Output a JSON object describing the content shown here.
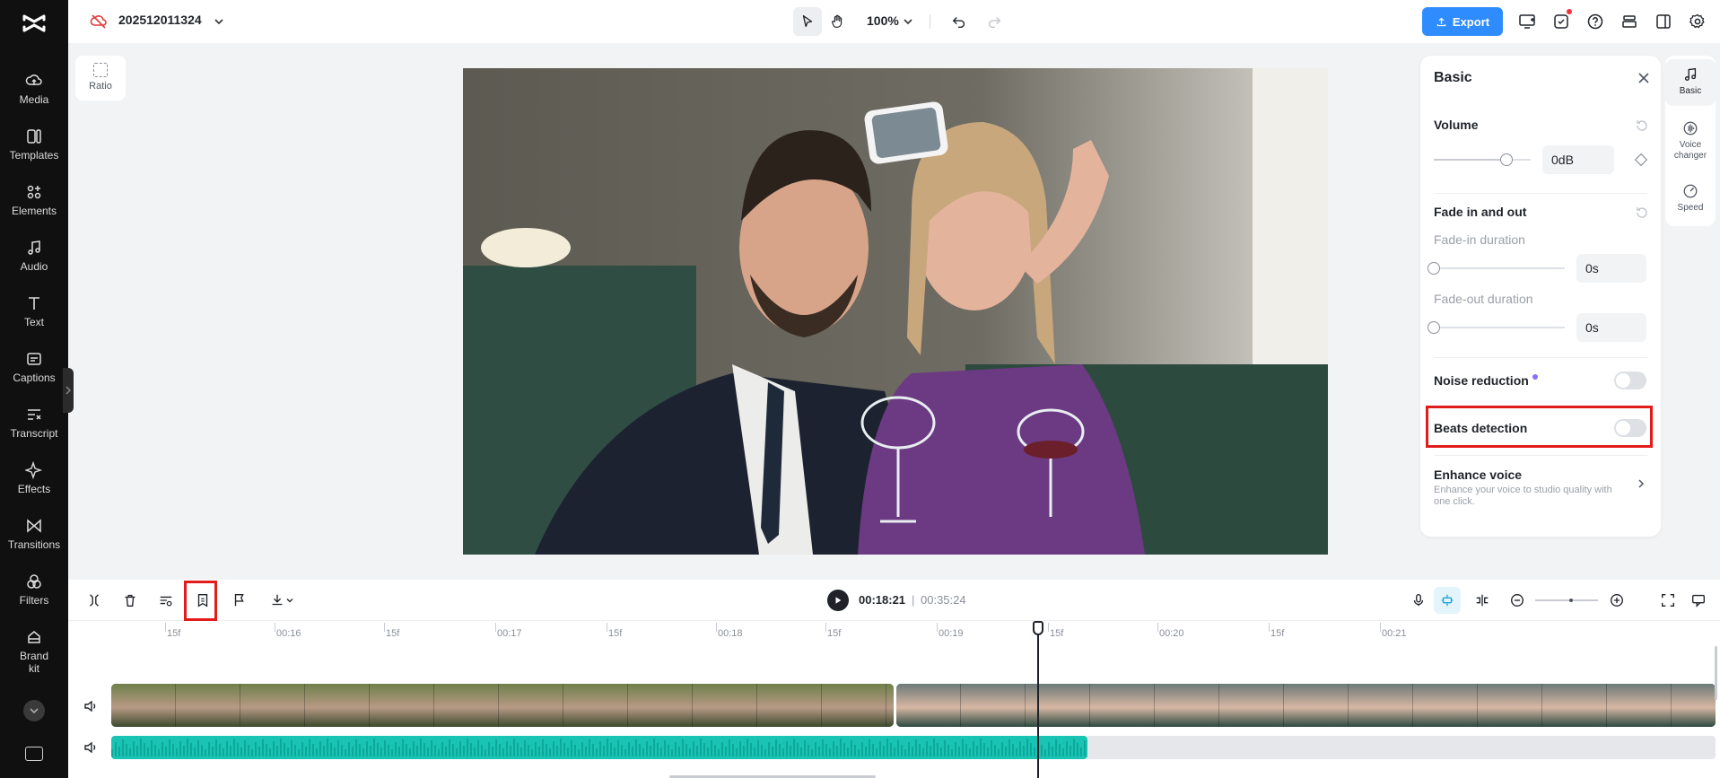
{
  "project": {
    "name": "202512011324"
  },
  "toolbar": {
    "zoom": "100%",
    "export_label": "Export"
  },
  "sidebar": {
    "items": [
      {
        "label": "Media",
        "icon": "cloud-upload-icon"
      },
      {
        "label": "Templates",
        "icon": "templates-icon"
      },
      {
        "label": "Elements",
        "icon": "elements-icon"
      },
      {
        "label": "Audio",
        "icon": "music-note-icon"
      },
      {
        "label": "Text",
        "icon": "text-icon"
      },
      {
        "label": "Captions",
        "icon": "captions-icon"
      },
      {
        "label": "Transcript",
        "icon": "transcript-icon"
      },
      {
        "label": "Effects",
        "icon": "sparkle-icon"
      },
      {
        "label": "Transitions",
        "icon": "transitions-icon"
      },
      {
        "label": "Filters",
        "icon": "filters-icon"
      },
      {
        "label": "Brand kit",
        "icon": "brand-kit-icon"
      }
    ]
  },
  "canvas": {
    "ratio_label": "Ratio"
  },
  "panel": {
    "title": "Basic",
    "volume": {
      "label": "Volume",
      "value": "0dB",
      "level": 0.75
    },
    "fade": {
      "label": "Fade in and out",
      "fade_in_label": "Fade-in duration",
      "fade_in_value": "0s",
      "fade_out_label": "Fade-out duration",
      "fade_out_value": "0s"
    },
    "noise_reduction": {
      "label": "Noise reduction",
      "enabled": false
    },
    "beats_detection": {
      "label": "Beats detection",
      "enabled": false
    },
    "enhance_voice": {
      "label": "Enhance voice",
      "description": "Enhance your voice to studio quality with one click."
    }
  },
  "rail": {
    "items": [
      {
        "label": "Basic",
        "active": true
      },
      {
        "label": "Voice changer",
        "active": false
      },
      {
        "label": "Speed",
        "active": false
      }
    ]
  },
  "playback": {
    "current": "00:18:21",
    "separator": "|",
    "total": "00:35:24"
  },
  "ruler": {
    "labels": [
      "15f",
      "00:16",
      "15f",
      "00:17",
      "15f",
      "00:18",
      "15f",
      "00:19",
      "15f",
      "00:20",
      "15f",
      "00:21"
    ]
  },
  "colors": {
    "accent": "#2f8cff",
    "audio_track": "#19c4b4",
    "highlight": "#e21b1b"
  }
}
